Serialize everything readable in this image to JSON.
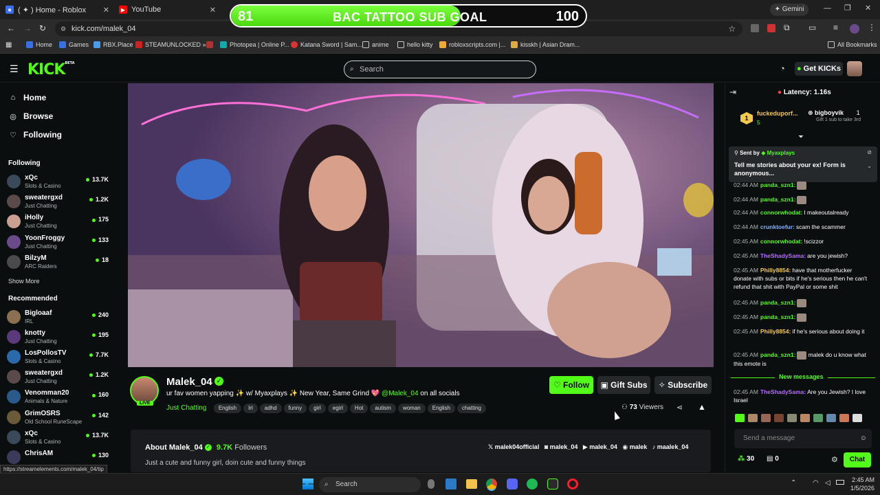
{
  "browser": {
    "tabs": [
      {
        "label": "( ✦ ) Home - Roblox",
        "icon": "roblox-icon"
      },
      {
        "label": "YouTube",
        "icon": "youtube-icon"
      }
    ],
    "gemini_label": "Gemini",
    "url": "kick.com/malek_04",
    "bookmarks": [
      "Home",
      "Games",
      "RBX.Place",
      "STEAMUNLOCKED »...",
      "Photopea | Online P...",
      "Katana Sword | Sam...",
      "anime",
      "hello kitty",
      "robloxscripts.com |...",
      "kisskh | Asian Dram..."
    ],
    "all_bookmarks": "All Bookmarks",
    "status_url": "https://streamelements.com/malek_04/tip"
  },
  "goal": {
    "current": "81",
    "title": "BAC TATTOO SUB GOAL",
    "target": "100",
    "progress": 0.81
  },
  "header": {
    "search_placeholder": "Search",
    "get_kicks": "Get KICKs"
  },
  "sidebar": {
    "nav": [
      {
        "label": "Home",
        "icon": "home-icon"
      },
      {
        "label": "Browse",
        "icon": "compass-icon"
      },
      {
        "label": "Following",
        "icon": "heart-icon"
      }
    ],
    "following_title": "Following",
    "following": [
      {
        "name": "xQc",
        "category": "Slots & Casino",
        "viewers": "13.7K",
        "color": "#3a4a5a"
      },
      {
        "name": "sweatergxd",
        "category": "Just Chatting",
        "viewers": "1.2K",
        "color": "#5a4a4a"
      },
      {
        "name": "iHolly",
        "category": "Just Chatting",
        "viewers": "175",
        "color": "#c9a090"
      },
      {
        "name": "YoonFroggy",
        "category": "Just Chatting",
        "viewers": "133",
        "color": "#6a4a8a"
      },
      {
        "name": "BilzyM",
        "category": "ARC Raiders",
        "viewers": "18",
        "color": "#4a4a4a"
      }
    ],
    "show_more": "Show More",
    "recommended_title": "Recommended",
    "recommended": [
      {
        "name": "Bigloaaf",
        "category": "IRL",
        "viewers": "240",
        "color": "#8a7050"
      },
      {
        "name": "knotty",
        "category": "Just Chatting",
        "viewers": "195",
        "color": "#5a3a7a"
      },
      {
        "name": "LosPollosTV",
        "category": "Slots & Casino",
        "viewers": "7.7K",
        "color": "#2a6aaa"
      },
      {
        "name": "sweatergxd",
        "category": "Just Chatting",
        "viewers": "1.2K",
        "color": "#5a4a4a"
      },
      {
        "name": "Venomman20",
        "category": "Animals & Nature",
        "viewers": "160",
        "color": "#2a5a8a"
      },
      {
        "name": "GrimOSRS",
        "category": "Old School RuneScape",
        "viewers": "142",
        "color": "#6a5a3a"
      },
      {
        "name": "xQc",
        "category": "Slots & Casino",
        "viewers": "13.7K",
        "color": "#3a4a5a"
      },
      {
        "name": "ChrisAM",
        "category": "",
        "viewers": "130",
        "color": "#3a3a5a"
      }
    ]
  },
  "stream": {
    "name": "Malek_04",
    "live": "LIVE",
    "title_main": "ur fav women yapping ✨ w/ Myaxplays ✨ New Year, Same Grind 💖",
    "title_handle": "@Malek_04",
    "title_tail": " on all socials",
    "category": "Just Chatting",
    "tags": [
      "English",
      "Irl",
      "adhd",
      "funny",
      "girl",
      "egirl",
      "Hot",
      "autism",
      "woman",
      "English",
      "chatting"
    ],
    "follow": "Follow",
    "gift_subs": "Gift Subs",
    "subscribe": "Subscribe",
    "viewers": "73",
    "viewers_label": "Viewers"
  },
  "about": {
    "title": "About Malek_04",
    "followers": "9.7K",
    "followers_label": "Followers",
    "bio": "Just a cute and funny girl, doin cute and funny things",
    "socials": [
      "malek04official",
      "malek_04",
      "malek_04",
      "malek",
      "maalek_04"
    ]
  },
  "chat": {
    "latency": "Latency: 1.16s",
    "leader_rank": "1",
    "leader_name": "fuckeduporf...",
    "leader_count": "5",
    "gifter_name": "bigboyvik",
    "gifter_count": "1",
    "gifter_note": "Gift 1 sub to take 3rd",
    "pinned_sent_by": "Sent by",
    "pinned_user": "Myaxplays",
    "pinned_text": "Tell me stories about your ex! Form is anonymous...",
    "messages": [
      {
        "time": "02:44 AM",
        "user": "panda_szn1:",
        "color": "#53fc18",
        "text": "",
        "emote": true
      },
      {
        "time": "02:44 AM",
        "user": "panda_szn1:",
        "color": "#53fc18",
        "text": "",
        "emote": true
      },
      {
        "time": "02:44 AM",
        "user": "connorwhodat:",
        "color": "#53fc18",
        "text": "I makeoutalready",
        "emote": false
      },
      {
        "time": "02:44 AM",
        "user": "crunktoefur:",
        "color": "#7fb3ff",
        "text": "scam the scammer",
        "emote": false
      },
      {
        "time": "02:45 AM",
        "user": "connorwhodat:",
        "color": "#53fc18",
        "text": "!scizzor",
        "emote": false
      },
      {
        "time": "02:45 AM",
        "user": "TheShadySama:",
        "color": "#b56cff",
        "text": "are you jewish?",
        "emote": false
      },
      {
        "time": "02:45 AM",
        "user": "Philly8854:",
        "color": "#f2c94c",
        "text": "have that motherfucker donate with subs or bits if he's serious then he can't refund that shit with PayPal or some shit",
        "emote": false
      },
      {
        "time": "02:45 AM",
        "user": "panda_szn1:",
        "color": "#53fc18",
        "text": "",
        "emote": true
      },
      {
        "time": "02:45 AM",
        "user": "panda_szn1:",
        "color": "#53fc18",
        "text": "",
        "emote": true
      },
      {
        "time": "02:45 AM",
        "user": "Philly8854:",
        "color": "#f2c94c",
        "text": "if he's serious about doing it",
        "emote": false
      },
      {
        "time": "02:45 AM",
        "user": "panda_szn1:",
        "color": "#53fc18",
        "text": "malek do u know what this emote is",
        "emote": true
      }
    ],
    "new_messages": "New messages",
    "last_msg": {
      "time": "02:45 AM",
      "user": "TheShadySama:",
      "color": "#b56cff",
      "text": "Are you Jewish? I love Israel"
    },
    "input_placeholder": "Send a message",
    "kicks": "30",
    "gifts": "0",
    "chat_button": "Chat"
  },
  "taskbar": {
    "search": "Search",
    "time": "2:45 AM",
    "date": "1/5/2026"
  }
}
